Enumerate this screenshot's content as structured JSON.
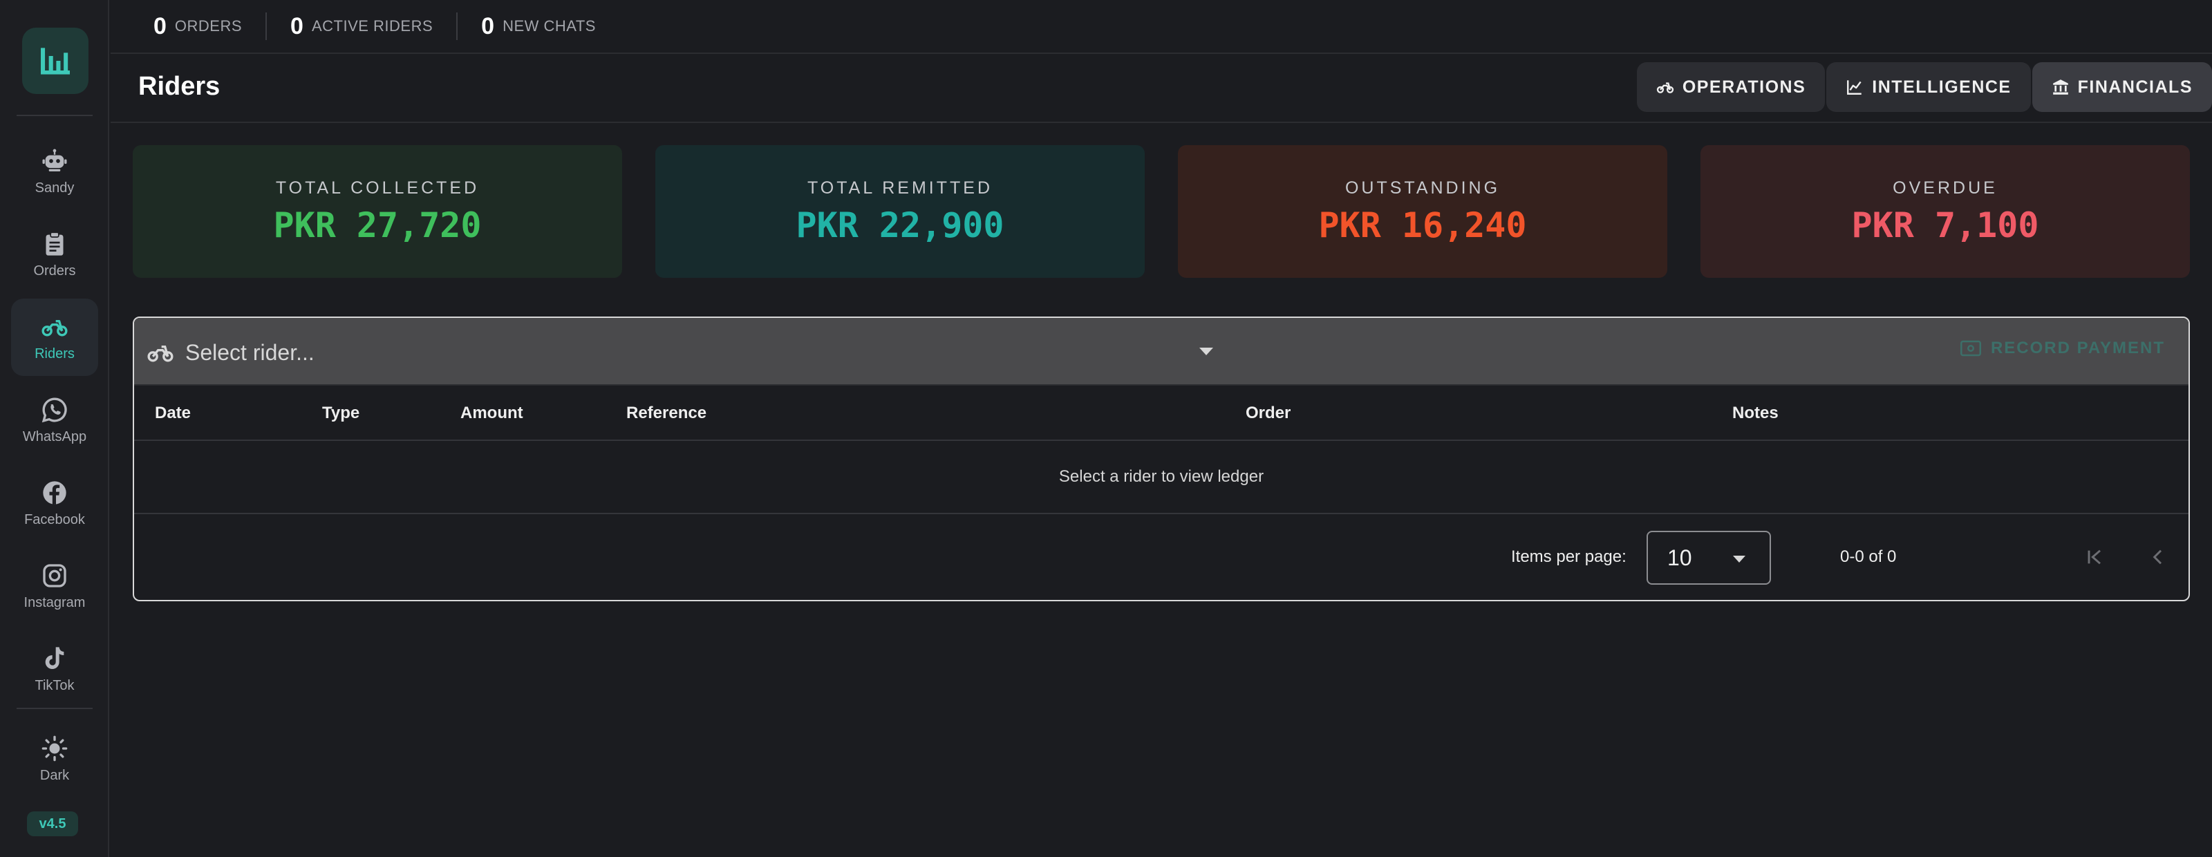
{
  "stats": [
    {
      "num": "0",
      "label": "ORDERS"
    },
    {
      "num": "0",
      "label": "ACTIVE RIDERS"
    },
    {
      "num": "0",
      "label": "NEW CHATS"
    }
  ],
  "sidebar": {
    "items": [
      {
        "label": "Sandy",
        "icon": "robot-icon"
      },
      {
        "label": "Orders",
        "icon": "clipboard-icon"
      },
      {
        "label": "Riders",
        "icon": "motorbike-icon",
        "active": true
      },
      {
        "label": "WhatsApp",
        "icon": "whatsapp-icon"
      },
      {
        "label": "Facebook",
        "icon": "facebook-icon"
      },
      {
        "label": "Instagram",
        "icon": "instagram-icon"
      },
      {
        "label": "TikTok",
        "icon": "tiktok-icon"
      }
    ],
    "theme_label": "Dark",
    "version": "v4.5"
  },
  "header": {
    "title": "Riders",
    "tabs": [
      {
        "label": "OPERATIONS",
        "icon": "motorbike-icon"
      },
      {
        "label": "INTELLIGENCE",
        "icon": "line-chart-icon"
      },
      {
        "label": "FINANCIALS",
        "icon": "bank-icon",
        "active": true
      }
    ]
  },
  "cards": [
    {
      "title": "TOTAL COLLECTED",
      "value": "PKR 27,720",
      "bg": "#1e2b24",
      "color": "#3fbf5c"
    },
    {
      "title": "TOTAL REMITTED",
      "value": "PKR 22,900",
      "bg": "#172b2d",
      "color": "#21b3a6"
    },
    {
      "title": "OUTSTANDING",
      "value": "PKR 16,240",
      "bg": "#35211d",
      "color": "#f2542a"
    },
    {
      "title": "OVERDUE",
      "value": "PKR 7,100",
      "bg": "#332122",
      "color": "#ef5a66"
    }
  ],
  "ledger": {
    "rider_placeholder": "Select rider...",
    "record_payment_label": "RECORD PAYMENT",
    "columns": [
      "Date",
      "Type",
      "Amount",
      "Reference",
      "Order",
      "Notes"
    ],
    "empty_message": "Select a rider to view ledger",
    "items_per_page_label": "Items per page:",
    "items_per_page_value": "10",
    "range_text": "0-0 of 0"
  },
  "colors": {
    "accent": "#3ec9b8",
    "background": "#1b1c20"
  }
}
